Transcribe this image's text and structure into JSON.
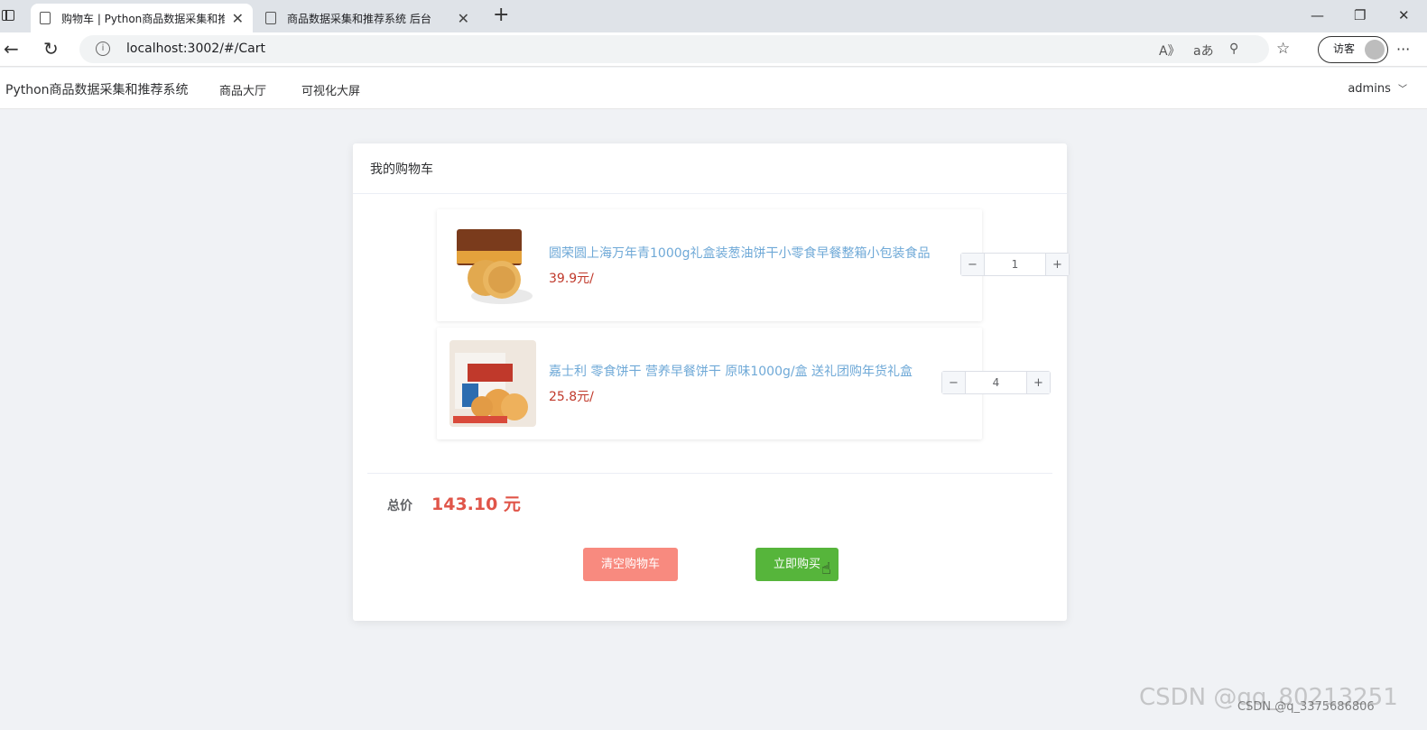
{
  "browser": {
    "tabs": [
      {
        "title": "购物车 | Python商品数据采集和推",
        "active": true
      },
      {
        "title": "商品数据采集和推荐系统 后台",
        "active": false
      }
    ],
    "new_tab": "+",
    "url": "localhost:3002/#/Cart",
    "guest_label": "访客",
    "more": "···"
  },
  "app": {
    "brand": "Python商品数据采集和推荐系统",
    "nav": [
      "商品大厅",
      "可视化大屏"
    ],
    "user": "admins"
  },
  "cart": {
    "title": "我的购物车",
    "items": [
      {
        "name": "圆荣圆上海万年青1000g礼盒装葱油饼干小零食早餐整箱小包装食品",
        "price": "39.9元/",
        "quantity": "1"
      },
      {
        "name": "嘉士利 零食饼干 营养早餐饼干 原味1000g/盒 送礼团购年货礼盒",
        "price": "25.8元/",
        "quantity": "4"
      }
    ],
    "total_label": "总价",
    "total_value": "143.10 元",
    "clear_button": "清空购物车",
    "buy_button": "立即购买"
  },
  "watermark": "CSDN @qq_80213251",
  "watermark2": "CSDN @q_3375686806"
}
